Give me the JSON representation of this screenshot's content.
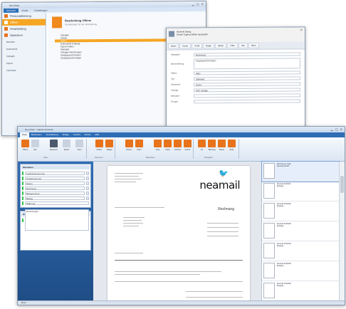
{
  "back_window": {
    "title": "Neo Client",
    "tabs": [
      "Übersicht",
      "Kunde",
      "Einstellungen"
    ],
    "nav": [
      "Personalisierung",
      "Offline",
      "Verarbeitung",
      "Speichern"
    ],
    "nav_sub": [
      "Benutzer",
      "Dokumente",
      "Vorlagen",
      "Export",
      "Formulare"
    ],
    "header_title": "Bearbeitung Offene",
    "header_subtitle": "Einstellungen für die Verarbeitung",
    "tree": [
      "Vorlagen",
      "Ordner",
      "Archiv",
      "Dokumente Eingang",
      "Export Ordner",
      "Standard",
      "Vorlagen Rechnungen",
      "Eingangsrechnungen",
      "Ausgangsrechnungen"
    ]
  },
  "dialog": {
    "title": "Neomail Dialog",
    "subtitle": "Ordner Eigenschaften bearbeiten",
    "tabs": [
      "Basis",
      "Konto",
      "Profil",
      "Regel",
      "Aktion",
      "Filter",
      "Info",
      "Mehr"
    ],
    "rows": [
      {
        "label": "Kategorie",
        "value": "Rechnung"
      },
      {
        "label": "Beschreibung",
        "value": "Eingangsrechnungen"
      },
      {
        "label": "Status",
        "value": "Aktiv"
      },
      {
        "label": "Typ",
        "value": "Standard"
      },
      {
        "label": "Zielordner",
        "value": "Archiv"
      },
      {
        "label": "Vorlage",
        "value": "PDF Vorlage"
      },
      {
        "label": "Benutzer",
        "value": ""
      },
      {
        "label": "Gruppe",
        "value": ""
      }
    ]
  },
  "main_window": {
    "title": "Neo Client - Capture Neomail",
    "menu": [
      "Datei",
      "Bearbeiten",
      "Verarbeitung",
      "Ablage",
      "Ansicht",
      "Extras",
      "Hilfe"
    ],
    "ribbon_buttons": [
      {
        "label": "Öffnen",
        "color": "#e8731b"
      },
      {
        "label": "Neu",
        "color": "#c9d3df"
      },
      {
        "label": "Speichern",
        "color": "#4b5a6c"
      },
      {
        "label": "Export",
        "color": "#c9d3df"
      },
      {
        "label": "Scan",
        "color": "#c9d3df"
      },
      {
        "label": "Ordner",
        "color": "#e8731b"
      },
      {
        "label": "Ablage",
        "color": "#e8731b"
      },
      {
        "label": "Drehen",
        "color": "#e8731b"
      },
      {
        "label": "Zoom",
        "color": "#e8731b"
      },
      {
        "label": "Seite",
        "color": "#e8731b"
      },
      {
        "label": "Kopie",
        "color": "#e8731b"
      },
      {
        "label": "Löschen",
        "color": "#e8731b"
      },
      {
        "label": "Zurück",
        "color": "#e8731b"
      },
      {
        "label": "Vor",
        "color": "#e8731b"
      },
      {
        "label": "Warnung",
        "color": "#e8731b"
      },
      {
        "label": "Weiter",
        "color": "#e8731b"
      },
      {
        "label": "Ende",
        "color": "#e8731b"
      }
    ],
    "ribbon_groups": [
      "Datei",
      "Dokument",
      "Bearbeiten",
      "Navigation"
    ],
    "left_panel1_title": "Metadaten",
    "fields": [
      "Lieferantennummer",
      "Kundennummer",
      "Datum",
      "Rechnung",
      "Belegnummer",
      "Betrag",
      "Währung"
    ],
    "left_panel2_title": "Dokumente",
    "left_panel2_item": "Rechnungen",
    "doc_logo": "neamail",
    "doc_title": "Rechnung",
    "thumbnails": [
      {
        "name": "Rechnung 1 Seite",
        "info": "Neomail GmbH"
      },
      {
        "name": "Neomail 2013001",
        "info": "Eingang"
      },
      {
        "name": "Neomail 2013002",
        "info": "Eingang"
      },
      {
        "name": "Neomail 2013003",
        "info": "Eingang"
      },
      {
        "name": "Neomail 2013004",
        "info": "Eingang"
      },
      {
        "name": "Neomail 2013005",
        "info": "Eingang"
      },
      {
        "name": "Neomail 2013006",
        "info": "Eingang"
      }
    ],
    "status": "Bereit"
  },
  "colors": {
    "accent": "#f5a623",
    "brand_blue": "#2f6db5",
    "field_marker": "#2ec24a"
  }
}
